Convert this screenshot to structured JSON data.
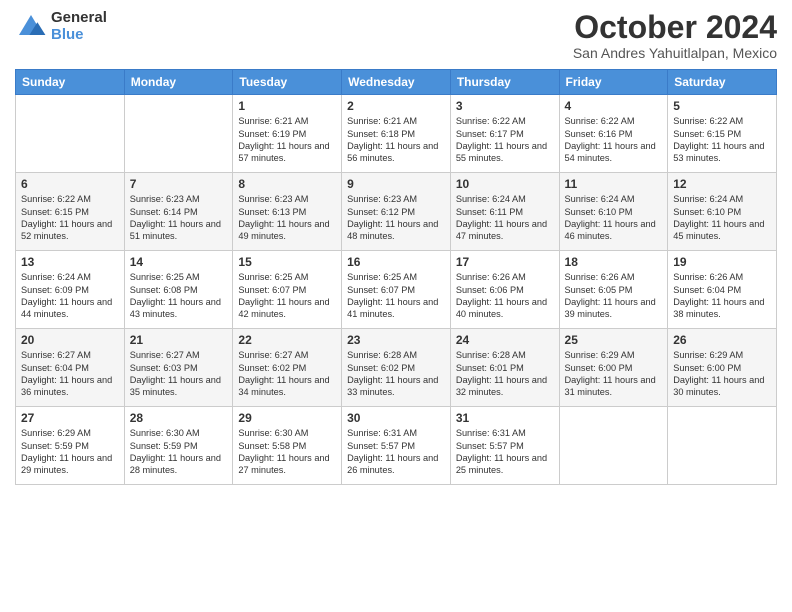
{
  "logo": {
    "general": "General",
    "blue": "Blue"
  },
  "title": "October 2024",
  "subtitle": "San Andres Yahuitlalpan, Mexico",
  "days_of_week": [
    "Sunday",
    "Monday",
    "Tuesday",
    "Wednesday",
    "Thursday",
    "Friday",
    "Saturday"
  ],
  "weeks": [
    [
      {
        "day": "",
        "info": ""
      },
      {
        "day": "",
        "info": ""
      },
      {
        "day": "1",
        "info": "Sunrise: 6:21 AM\nSunset: 6:19 PM\nDaylight: 11 hours and 57 minutes."
      },
      {
        "day": "2",
        "info": "Sunrise: 6:21 AM\nSunset: 6:18 PM\nDaylight: 11 hours and 56 minutes."
      },
      {
        "day": "3",
        "info": "Sunrise: 6:22 AM\nSunset: 6:17 PM\nDaylight: 11 hours and 55 minutes."
      },
      {
        "day": "4",
        "info": "Sunrise: 6:22 AM\nSunset: 6:16 PM\nDaylight: 11 hours and 54 minutes."
      },
      {
        "day": "5",
        "info": "Sunrise: 6:22 AM\nSunset: 6:15 PM\nDaylight: 11 hours and 53 minutes."
      }
    ],
    [
      {
        "day": "6",
        "info": "Sunrise: 6:22 AM\nSunset: 6:15 PM\nDaylight: 11 hours and 52 minutes."
      },
      {
        "day": "7",
        "info": "Sunrise: 6:23 AM\nSunset: 6:14 PM\nDaylight: 11 hours and 51 minutes."
      },
      {
        "day": "8",
        "info": "Sunrise: 6:23 AM\nSunset: 6:13 PM\nDaylight: 11 hours and 49 minutes."
      },
      {
        "day": "9",
        "info": "Sunrise: 6:23 AM\nSunset: 6:12 PM\nDaylight: 11 hours and 48 minutes."
      },
      {
        "day": "10",
        "info": "Sunrise: 6:24 AM\nSunset: 6:11 PM\nDaylight: 11 hours and 47 minutes."
      },
      {
        "day": "11",
        "info": "Sunrise: 6:24 AM\nSunset: 6:10 PM\nDaylight: 11 hours and 46 minutes."
      },
      {
        "day": "12",
        "info": "Sunrise: 6:24 AM\nSunset: 6:10 PM\nDaylight: 11 hours and 45 minutes."
      }
    ],
    [
      {
        "day": "13",
        "info": "Sunrise: 6:24 AM\nSunset: 6:09 PM\nDaylight: 11 hours and 44 minutes."
      },
      {
        "day": "14",
        "info": "Sunrise: 6:25 AM\nSunset: 6:08 PM\nDaylight: 11 hours and 43 minutes."
      },
      {
        "day": "15",
        "info": "Sunrise: 6:25 AM\nSunset: 6:07 PM\nDaylight: 11 hours and 42 minutes."
      },
      {
        "day": "16",
        "info": "Sunrise: 6:25 AM\nSunset: 6:07 PM\nDaylight: 11 hours and 41 minutes."
      },
      {
        "day": "17",
        "info": "Sunrise: 6:26 AM\nSunset: 6:06 PM\nDaylight: 11 hours and 40 minutes."
      },
      {
        "day": "18",
        "info": "Sunrise: 6:26 AM\nSunset: 6:05 PM\nDaylight: 11 hours and 39 minutes."
      },
      {
        "day": "19",
        "info": "Sunrise: 6:26 AM\nSunset: 6:04 PM\nDaylight: 11 hours and 38 minutes."
      }
    ],
    [
      {
        "day": "20",
        "info": "Sunrise: 6:27 AM\nSunset: 6:04 PM\nDaylight: 11 hours and 36 minutes."
      },
      {
        "day": "21",
        "info": "Sunrise: 6:27 AM\nSunset: 6:03 PM\nDaylight: 11 hours and 35 minutes."
      },
      {
        "day": "22",
        "info": "Sunrise: 6:27 AM\nSunset: 6:02 PM\nDaylight: 11 hours and 34 minutes."
      },
      {
        "day": "23",
        "info": "Sunrise: 6:28 AM\nSunset: 6:02 PM\nDaylight: 11 hours and 33 minutes."
      },
      {
        "day": "24",
        "info": "Sunrise: 6:28 AM\nSunset: 6:01 PM\nDaylight: 11 hours and 32 minutes."
      },
      {
        "day": "25",
        "info": "Sunrise: 6:29 AM\nSunset: 6:00 PM\nDaylight: 11 hours and 31 minutes."
      },
      {
        "day": "26",
        "info": "Sunrise: 6:29 AM\nSunset: 6:00 PM\nDaylight: 11 hours and 30 minutes."
      }
    ],
    [
      {
        "day": "27",
        "info": "Sunrise: 6:29 AM\nSunset: 5:59 PM\nDaylight: 11 hours and 29 minutes."
      },
      {
        "day": "28",
        "info": "Sunrise: 6:30 AM\nSunset: 5:59 PM\nDaylight: 11 hours and 28 minutes."
      },
      {
        "day": "29",
        "info": "Sunrise: 6:30 AM\nSunset: 5:58 PM\nDaylight: 11 hours and 27 minutes."
      },
      {
        "day": "30",
        "info": "Sunrise: 6:31 AM\nSunset: 5:57 PM\nDaylight: 11 hours and 26 minutes."
      },
      {
        "day": "31",
        "info": "Sunrise: 6:31 AM\nSunset: 5:57 PM\nDaylight: 11 hours and 25 minutes."
      },
      {
        "day": "",
        "info": ""
      },
      {
        "day": "",
        "info": ""
      }
    ]
  ]
}
